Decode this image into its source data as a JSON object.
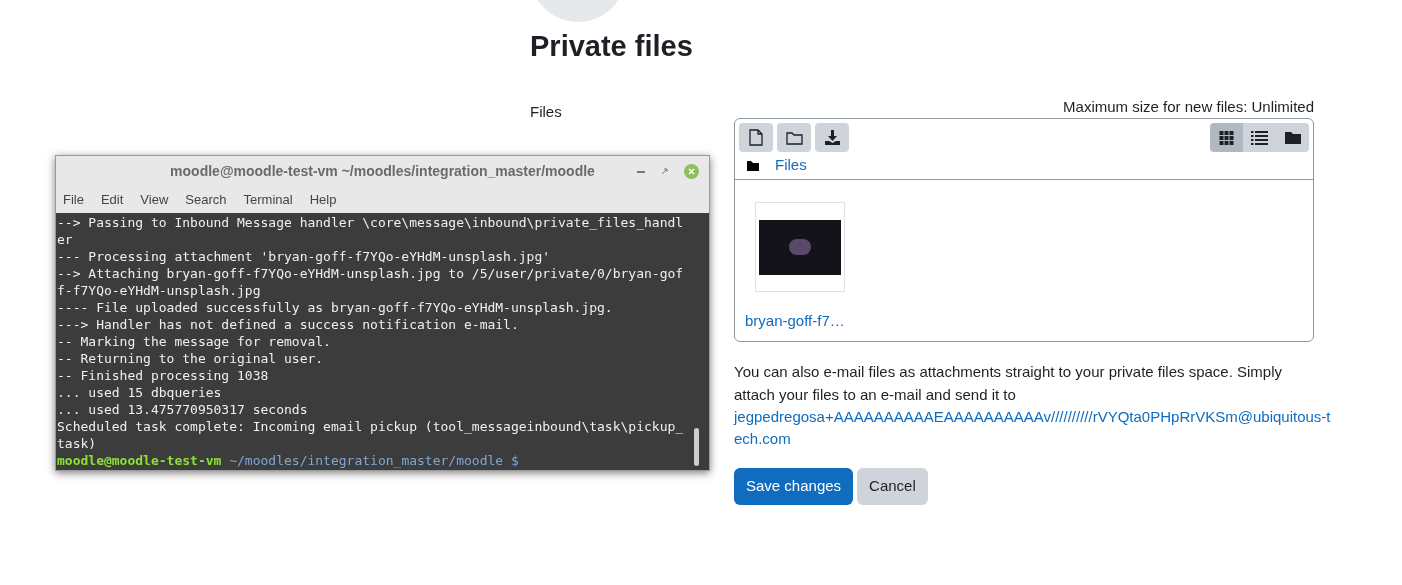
{
  "page": {
    "title": "Private files"
  },
  "form": {
    "label": "Files",
    "max_size": "Maximum size for new files: Unlimited",
    "toolbar": [
      {
        "kind": "file"
      },
      {
        "kind": "folder"
      },
      {
        "kind": "download"
      }
    ],
    "views": [
      {
        "kind": "grid",
        "selected": true
      },
      {
        "kind": "list",
        "selected": false
      },
      {
        "kind": "tree",
        "selected": false
      }
    ],
    "breadcrumb": "Files",
    "files": [
      {
        "name": "bryan-goff-f7…"
      }
    ],
    "note": "You can also e-mail files as attachments straight to your private files space. Simply attach your files to an e-mail and send it to",
    "email": "jegpedregosa+AAAAAAAAAAEAAAAAAAAAAv//////////rVYQta0PHpRrVKSm@ubiquitous-tech.com",
    "buttons": [
      {
        "label": "Save changes",
        "kind": "primary"
      },
      {
        "label": "Cancel",
        "kind": "secondary"
      }
    ]
  },
  "terminal": {
    "title": "moodle@moodle-test-vm ~/moodles/integration_master/moodle",
    "menu": [
      "File",
      "Edit",
      "View",
      "Search",
      "Terminal",
      "Help"
    ],
    "lines": [
      "--> Passing to Inbound Message handler \\core\\message\\inbound\\private_files_handler",
      "--- Processing attachment 'bryan-goff-f7YQo-eYHdM-unsplash.jpg'",
      "--> Attaching bryan-goff-f7YQo-eYHdM-unsplash.jpg to /5/user/private/0/bryan-goff-f7YQo-eYHdM-unsplash.jpg",
      "---- File uploaded successfully as bryan-goff-f7YQo-eYHdM-unsplash.jpg.",
      "---> Handler has not defined a success notification e-mail.",
      "-- Marking the message for removal.",
      "-- Returning to the original user.",
      "-- Finished processing 1038",
      "... used 15 dbqueries",
      "... used 13.475770950317 seconds",
      "Scheduled task complete: Incoming email pickup (tool_messageinbound\\task\\pickup_task)"
    ],
    "prompt_user": "moodle@moodle-test-vm",
    "prompt_path": "~/moodles/integration_master/moodle $"
  }
}
